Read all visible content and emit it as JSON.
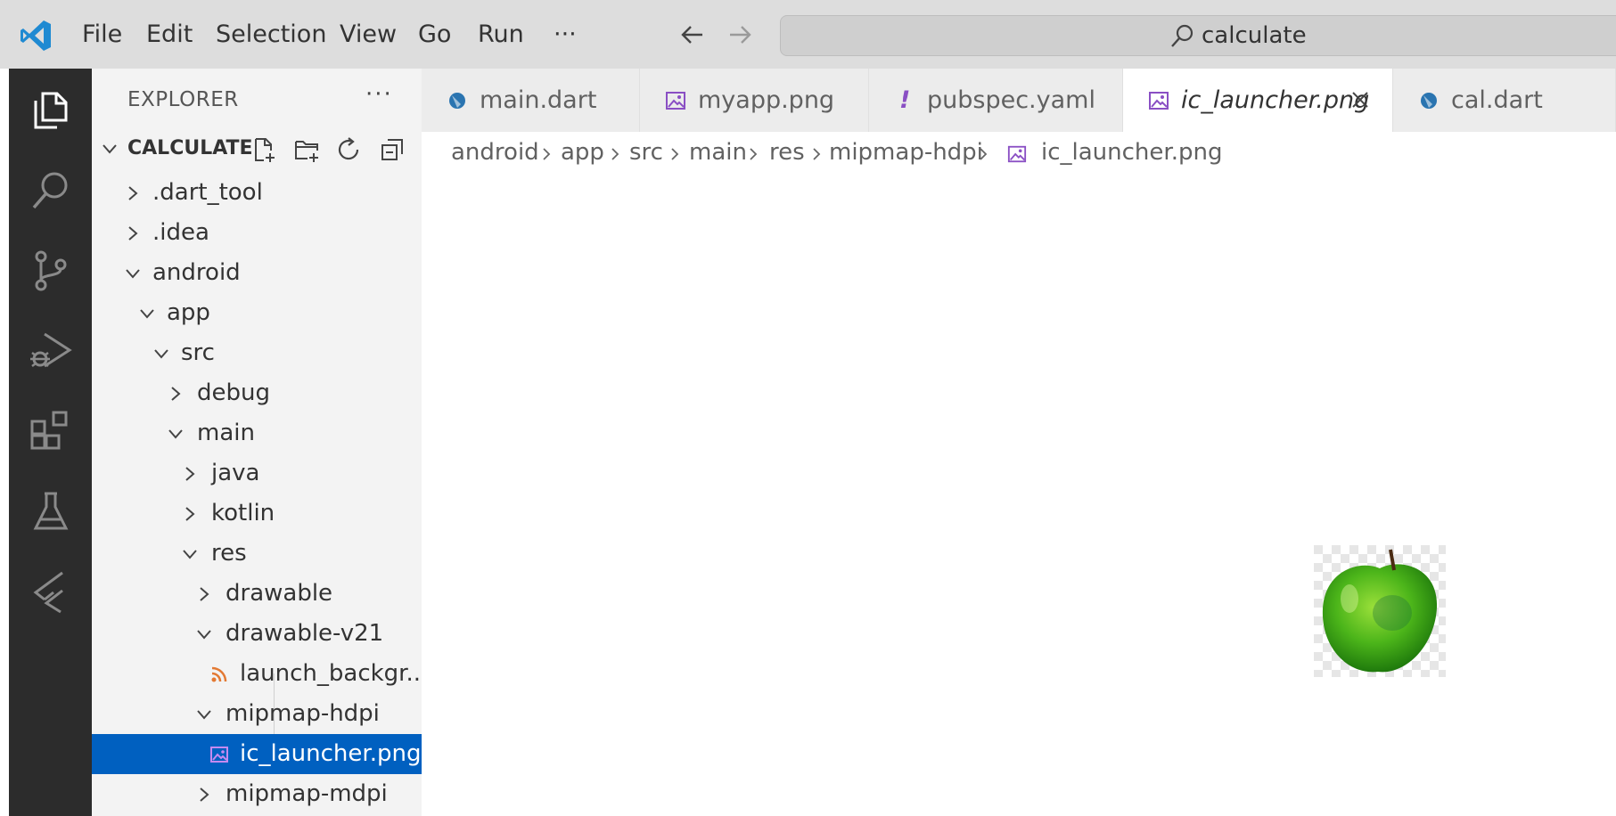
{
  "menu": {
    "file": "File",
    "edit": "Edit",
    "selection": "Selection",
    "view": "View",
    "go": "Go",
    "run": "Run",
    "more": "···"
  },
  "search": {
    "text": "calculate"
  },
  "sidebar": {
    "title": "EXPLORER",
    "more": "···",
    "section": "CALCULATE",
    "tree": [
      {
        "label": ".dart_tool"
      },
      {
        "label": ".idea"
      },
      {
        "label": "android"
      },
      {
        "label": "app"
      },
      {
        "label": "src"
      },
      {
        "label": "debug"
      },
      {
        "label": "main"
      },
      {
        "label": "java"
      },
      {
        "label": "kotlin"
      },
      {
        "label": "res"
      },
      {
        "label": "drawable"
      },
      {
        "label": "drawable-v21"
      },
      {
        "label": "launch_backgr..."
      },
      {
        "label": "mipmap-hdpi"
      },
      {
        "label": "ic_launcher.png"
      },
      {
        "label": "mipmap-mdpi"
      }
    ]
  },
  "tabs": [
    {
      "label": "main.dart",
      "icon": "dart-file-icon"
    },
    {
      "label": "myapp.png",
      "icon": "image-file-icon"
    },
    {
      "label": "pubspec.yaml",
      "icon": "yaml-file-icon",
      "bang": "!"
    },
    {
      "label": "ic_launcher.png",
      "icon": "image-file-icon",
      "active": true
    },
    {
      "label": "cal.dart",
      "icon": "dart-file-icon"
    }
  ],
  "breadcrumb": [
    "android",
    "app",
    "src",
    "main",
    "res",
    "mipmap-hdpi",
    "ic_launcher.png"
  ],
  "colors": {
    "accent_selection": "#0060c0",
    "activity_bar": "#2c2c2c",
    "sidebar": "#f3f3f3",
    "titlebar": "#dddddd",
    "image_icon": "#8a4fc4",
    "xml_icon": "#e37933",
    "dart_icon": "#2a74b0"
  }
}
